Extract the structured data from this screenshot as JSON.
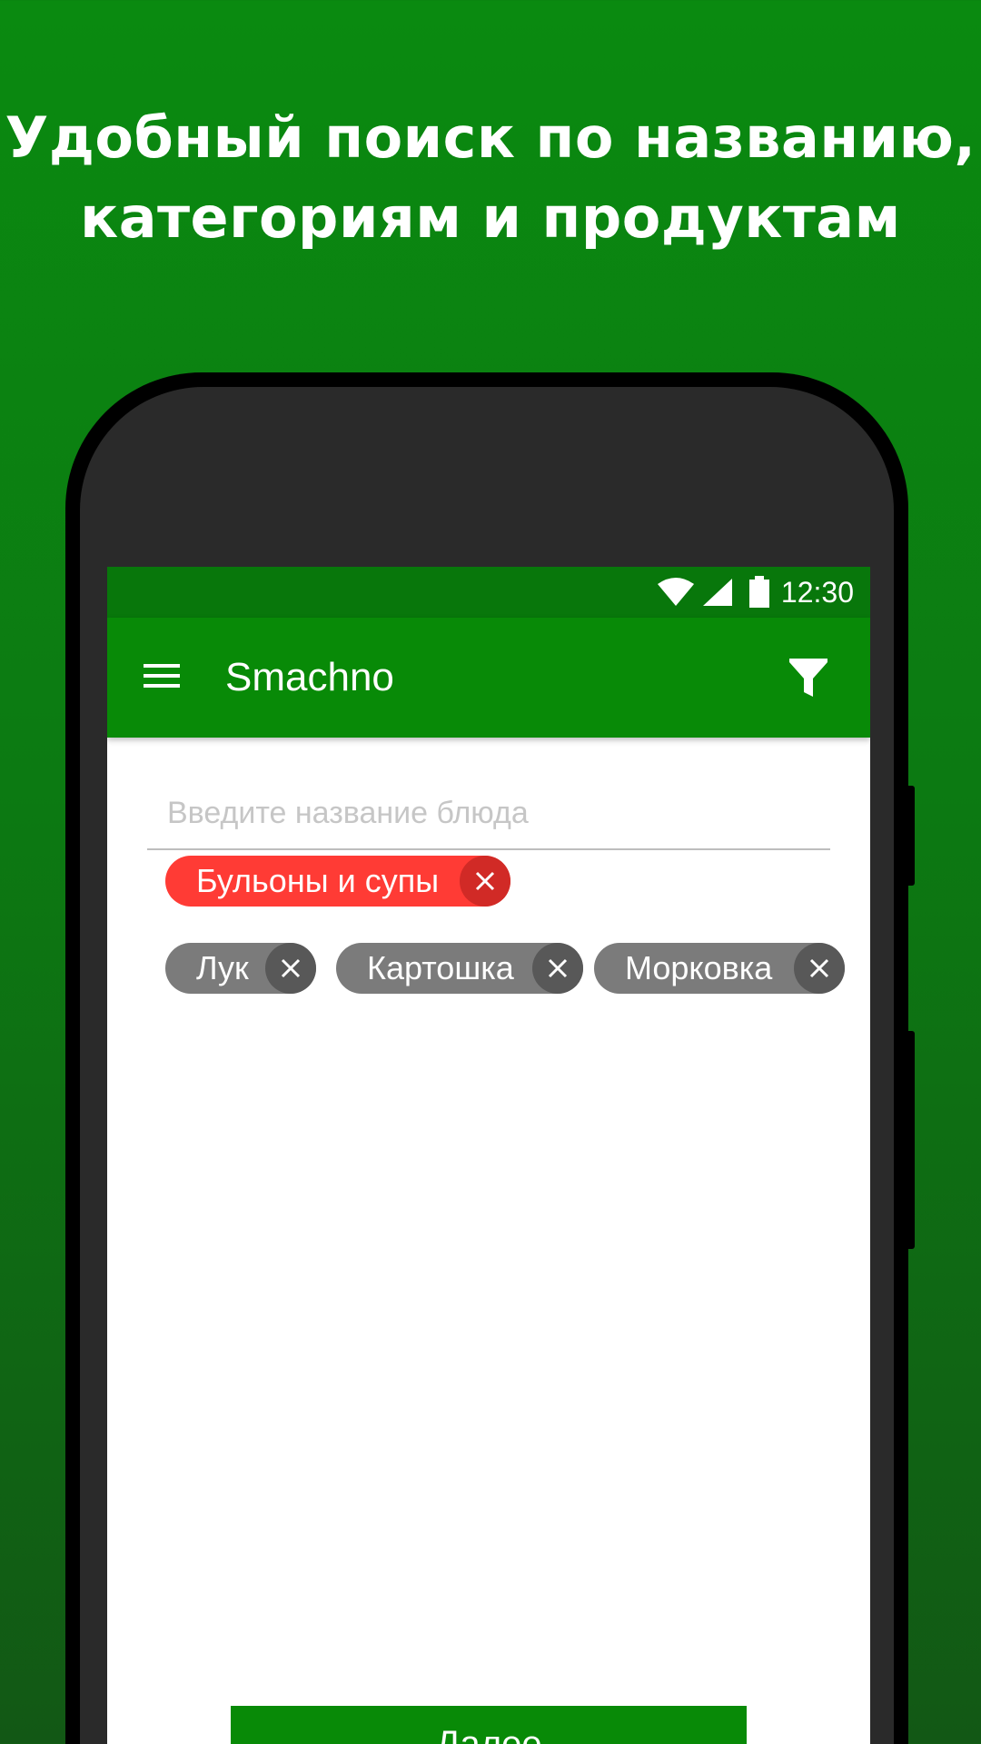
{
  "promo": {
    "headline_line1": "Удобный поиск по названию,",
    "headline_line2": "категориям и продуктам"
  },
  "status_bar": {
    "time": "12:30",
    "icons": [
      "wifi-icon",
      "signal-icon",
      "battery-icon"
    ]
  },
  "app_bar": {
    "title": "Smachno",
    "menu_icon": "menu-icon",
    "filter_icon": "filter-icon"
  },
  "search": {
    "placeholder": "Введите название блюда",
    "value": ""
  },
  "category_chips": [
    {
      "label": "Бульоны и супы"
    }
  ],
  "product_chips": [
    {
      "label": "Лук"
    },
    {
      "label": "Картошка"
    },
    {
      "label": "Морковка"
    }
  ],
  "next_button": {
    "label": "Далее"
  },
  "colors": {
    "background": "#0a8a10",
    "app_bar": "#088a07",
    "status_bar": "#08770b",
    "category_chip": "#ff3b35",
    "product_chip": "#7b7b7b"
  }
}
